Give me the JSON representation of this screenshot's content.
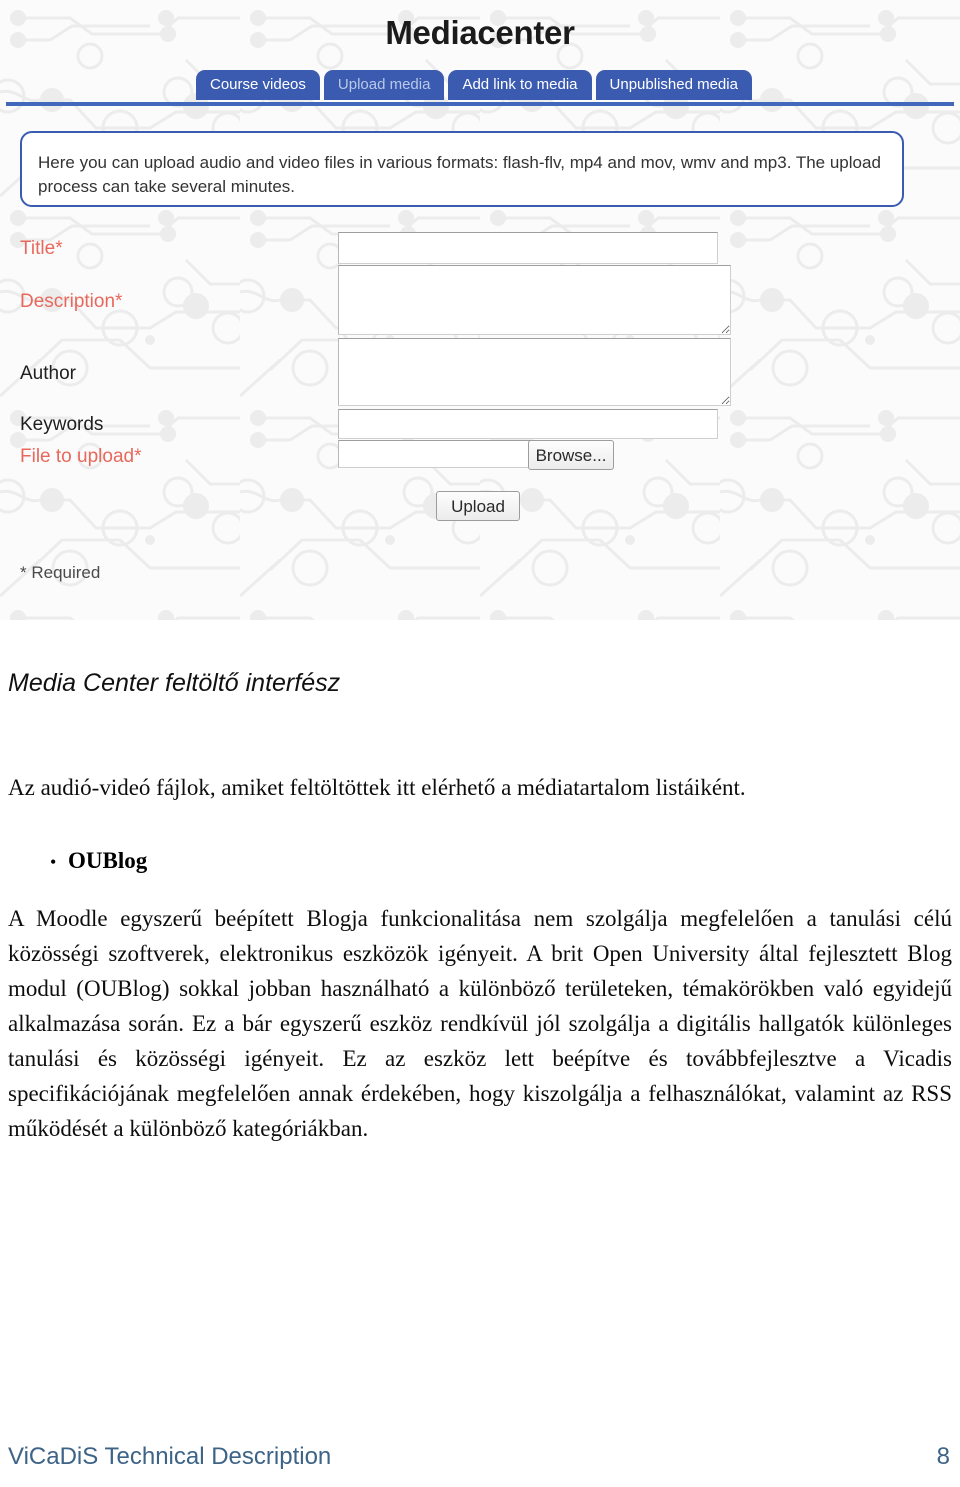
{
  "screenshot": {
    "app_title": "Mediacenter",
    "tabs": [
      {
        "label": "Course videos",
        "active": false
      },
      {
        "label": "Upload media",
        "active": true
      },
      {
        "label": "Add link to media",
        "active": false
      },
      {
        "label": "Unpublished media",
        "active": false
      }
    ],
    "info_text": "Here you can upload audio and video files in various formats: flash-flv, mp4 and mov, wmv and mp3. The upload process can take several minutes.",
    "form": {
      "fields": [
        {
          "label": "Title*",
          "required": true,
          "value": ""
        },
        {
          "label": "Description*",
          "required": true,
          "value": ""
        },
        {
          "label": "Author",
          "required": false,
          "value": ""
        },
        {
          "label": "Keywords",
          "required": false,
          "value": ""
        },
        {
          "label": "File to upload*",
          "required": true,
          "value": ""
        }
      ],
      "browse_label": "Browse...",
      "upload_label": "Upload",
      "required_note": "* Required"
    },
    "colors": {
      "tab_background": "#3a5bb0",
      "tab_active_text": "#b9c8ea",
      "rule": "#4268bb",
      "required_label": "#e8685c",
      "info_border": "#3a5bb0"
    }
  },
  "document": {
    "caption": "Media Center feltöltő interfész",
    "lead": "Az audió-videó fájlok, amiket feltöltöttek itt elérhető a médiatartalom listáiként.",
    "bullet_marker": "•",
    "bullet_label": "OUBlog",
    "paragraph": "A Moodle egyszerű beépített Blogja funkcionalitása nem szolgálja megfelelően a tanulási célú közösségi szoftverek, elektronikus eszközök igényeit. A brit Open University által fejlesztett Blog modul (OUBlog) sokkal jobban használható a különböző területeken, témakörökben való egyidejű alkalmazása során. Ez a bár egyszerű eszköz rendkívül jól szolgálja a digitális hallgatók különleges tanulási és közösségi igényeit. Ez az eszköz lett beépítve és továbbfejlesztve a Vicadis specifikációjának megfelelően annak érdekében, hogy kiszolgálja a felhasználókat, valamint az RSS működését a különböző kategóriákban."
  },
  "footer": {
    "left": "ViCaDiS Technical Description",
    "page_number": "8",
    "color": "#3d6387"
  }
}
